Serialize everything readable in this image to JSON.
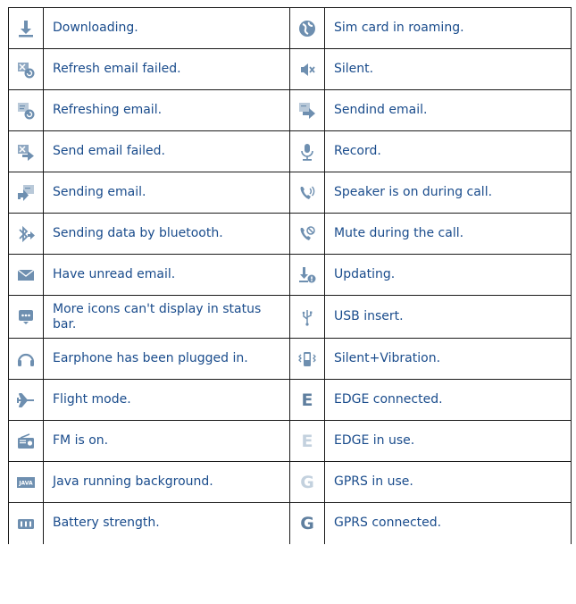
{
  "colors": {
    "text": "#1a4c8c",
    "icon": "#6e8fb0",
    "icon_light": "#b9c9d9",
    "border": "#1a1a1a"
  },
  "rows": [
    {
      "left": {
        "icon": "download-icon",
        "text": "Downloading."
      },
      "right": {
        "icon": "globe-roaming-icon",
        "text": "Sim card in roaming."
      }
    },
    {
      "left": {
        "icon": "refresh-email-failed-icon",
        "text": "Refresh email failed."
      },
      "right": {
        "icon": "silent-icon",
        "text": "Silent."
      }
    },
    {
      "left": {
        "icon": "refreshing-email-icon",
        "text": "Refreshing email."
      },
      "right": {
        "icon": "sending-email-arrow-icon",
        "text": "Sendind email."
      }
    },
    {
      "left": {
        "icon": "send-email-failed-icon",
        "text": "Send email failed."
      },
      "right": {
        "icon": "microphone-icon",
        "text": "Record."
      }
    },
    {
      "left": {
        "icon": "sending-email-icon",
        "text": "Sending email."
      },
      "right": {
        "icon": "speaker-call-icon",
        "text": "Speaker is on during call."
      }
    },
    {
      "left": {
        "icon": "bluetooth-data-icon",
        "text": "Sending data by bluetooth."
      },
      "right": {
        "icon": "mute-call-icon",
        "text": "Mute during the call."
      }
    },
    {
      "left": {
        "icon": "envelope-icon",
        "text": "Have unread email."
      },
      "right": {
        "icon": "updating-icon",
        "text": "Updating."
      }
    },
    {
      "left": {
        "icon": "more-icons-icon",
        "text": "More icons can't display in status bar."
      },
      "right": {
        "icon": "usb-icon",
        "text": "USB insert."
      }
    },
    {
      "left": {
        "icon": "headphones-icon",
        "text": "Earphone has been plugged in."
      },
      "right": {
        "icon": "vibrate-icon",
        "text": "Silent+Vibration."
      }
    },
    {
      "left": {
        "icon": "airplane-icon",
        "text": "Flight mode."
      },
      "right": {
        "icon": "edge-connected-icon",
        "letter": "E",
        "text": "EDGE connected."
      }
    },
    {
      "left": {
        "icon": "radio-icon",
        "text": "FM is on."
      },
      "right": {
        "icon": "edge-in-use-icon",
        "letter": "E",
        "text": "EDGE in use."
      }
    },
    {
      "left": {
        "icon": "java-icon",
        "label": "JAVA",
        "text": "Java running background."
      },
      "right": {
        "icon": "gprs-in-use-icon",
        "letter": "G",
        "text": "GPRS in use."
      }
    },
    {
      "left": {
        "icon": "battery-icon",
        "text": "Battery strength."
      },
      "right": {
        "icon": "gprs-connected-icon",
        "letter": "G",
        "text": "GPRS connected."
      }
    }
  ]
}
